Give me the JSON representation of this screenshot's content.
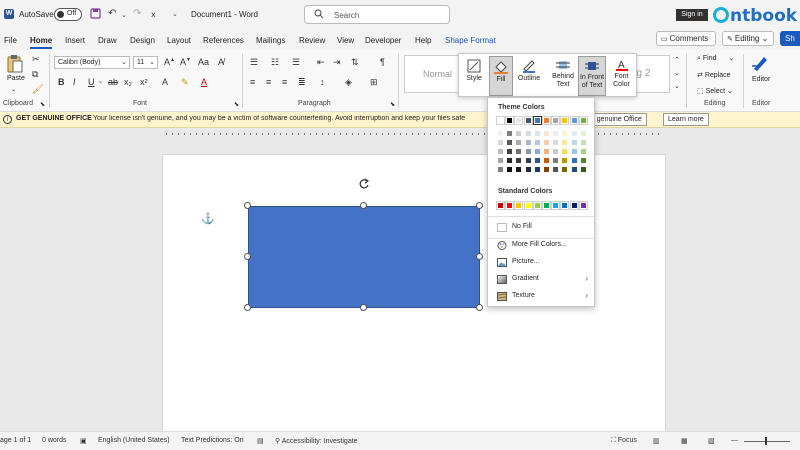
{
  "titlebar": {
    "autosave_label": "AutoSave",
    "autosave_state": "Off",
    "doc_title": "Document1  -  Word",
    "search_placeholder": "Search",
    "sign_in": "Sign in",
    "brand": "ntbook"
  },
  "tabs": [
    "File",
    "Home",
    "Insert",
    "Draw",
    "Design",
    "Layout",
    "References",
    "Mailings",
    "Review",
    "View",
    "Developer",
    "Help",
    "Shape Format"
  ],
  "active_tab": "Home",
  "right_buttons": {
    "comments": "Comments",
    "editing": "Editing",
    "share": "Sh"
  },
  "ribbon": {
    "clipboard": {
      "label": "Clipboard",
      "paste": "Paste"
    },
    "font": {
      "label": "Font",
      "font_name": "Calibri (Body)",
      "font_size": "11"
    },
    "paragraph": {
      "label": "Paragraph"
    },
    "styles": {
      "normal": "Normal",
      "heading2": "ng 2"
    },
    "shape_format": {
      "style": "Style",
      "fill": "Fill",
      "outline": "Outline",
      "behind_text": "Behind Text",
      "in_front_of_text": "In Front of Text",
      "font_color": "Font Color"
    },
    "editing": {
      "label": "Editing",
      "find": "Find",
      "replace": "Replace",
      "select": "Select"
    },
    "editor": {
      "label": "Editor",
      "button": "Editor"
    }
  },
  "infobar": {
    "title": "GET GENUINE OFFICE",
    "message": "Your license isn't genuine, and you may be a victim of software counterfeiting. Avoid interruption and keep your files safe",
    "get_genuine": "et genuine Office",
    "learn_more": "Learn more"
  },
  "fill_menu": {
    "theme_colors_label": "Theme Colors",
    "standard_colors_label": "Standard Colors",
    "theme_top": [
      "#ffffff",
      "#000000",
      "#e7e6e6",
      "#44546a",
      "#4472c4",
      "#ed7d31",
      "#a5a5a5",
      "#ffc000",
      "#5b9bd5",
      "#70ad47"
    ],
    "theme_shades": [
      [
        "#f2f2f2",
        "#808080",
        "#d0cece",
        "#d6dce5",
        "#dae3f3",
        "#fbe5d6",
        "#ededed",
        "#fff2cc",
        "#deebf7",
        "#e2f0d9"
      ],
      [
        "#d9d9d9",
        "#595959",
        "#aeabab",
        "#adb9ca",
        "#b4c7e7",
        "#f8cbad",
        "#dbdbdb",
        "#ffe699",
        "#bdd7ee",
        "#c5e0b4"
      ],
      [
        "#bfbfbf",
        "#404040",
        "#757171",
        "#8497b0",
        "#8faadc",
        "#f4b183",
        "#c9c9c9",
        "#ffd966",
        "#9dc3e6",
        "#a9d18e"
      ],
      [
        "#a6a6a6",
        "#262626",
        "#3a3838",
        "#333f50",
        "#2f5597",
        "#c55a11",
        "#7b7b7b",
        "#bf9000",
        "#2e75b6",
        "#548235"
      ],
      [
        "#808080",
        "#0d0d0d",
        "#171616",
        "#222a35",
        "#1f3864",
        "#843c0c",
        "#525252",
        "#7f6000",
        "#1f4e79",
        "#385723"
      ]
    ],
    "standard": [
      "#c00000",
      "#ff0000",
      "#ffc000",
      "#ffff00",
      "#92d050",
      "#00b050",
      "#00b0f0",
      "#0070c0",
      "#002060",
      "#7030a0"
    ],
    "items": {
      "no_fill": "No Fill",
      "more_fill": "More Fill Colors...",
      "picture": "Picture...",
      "gradient": "Gradient",
      "texture": "Texture"
    }
  },
  "shape": {
    "fill": "#4472c4"
  },
  "statusbar": {
    "page": "age 1 of 1",
    "words": "0 words",
    "language": "English (United States)",
    "predictions": "Text Predictions: On",
    "accessibility": "Accessibility: Investigate",
    "focus": "Focus"
  }
}
